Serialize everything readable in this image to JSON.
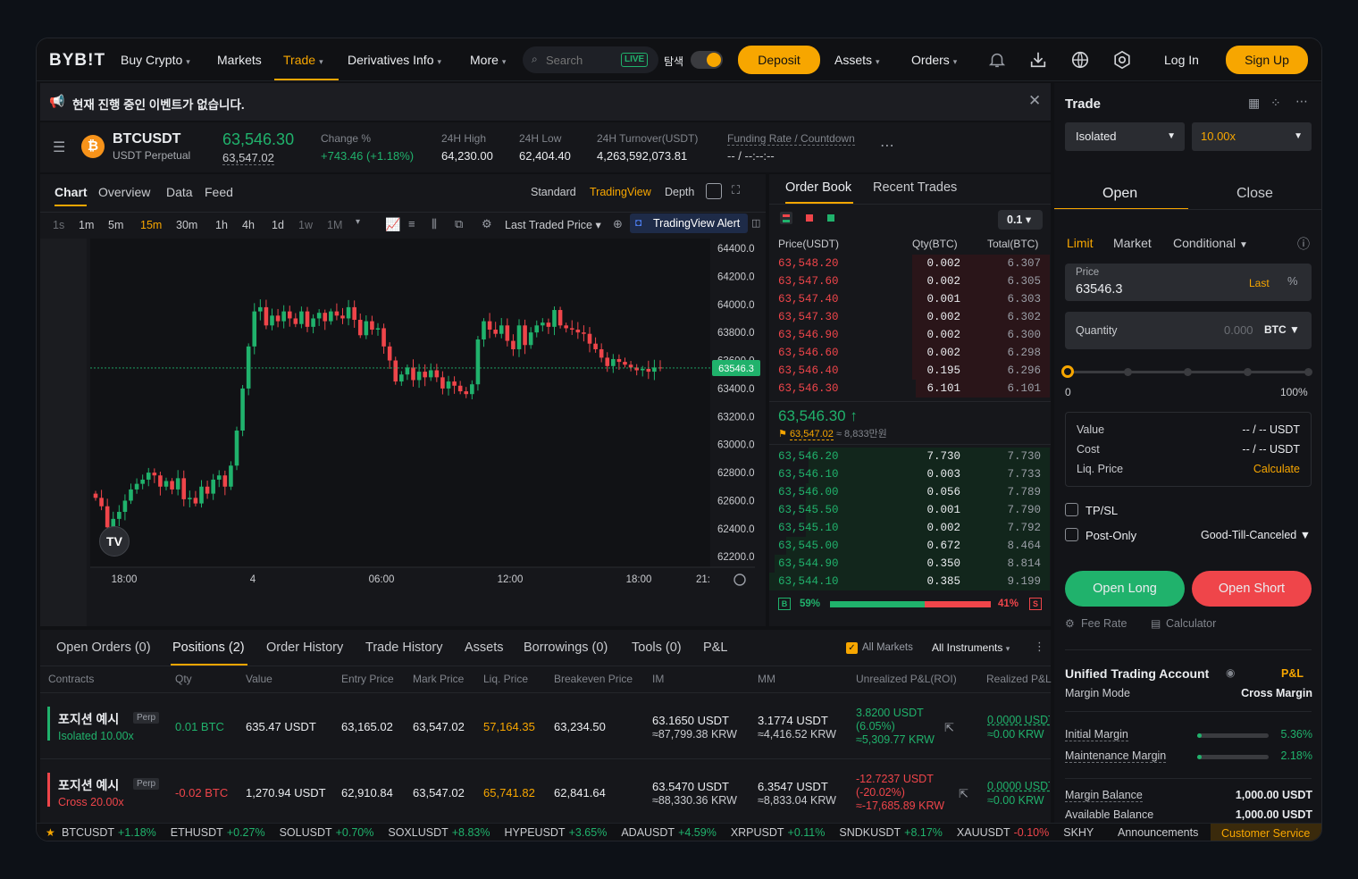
{
  "nav": {
    "logo": "BYB!T",
    "buy_crypto": "Buy Crypto",
    "markets": "Markets",
    "trade": "Trade",
    "derivatives": "Derivatives Info",
    "more": "More",
    "search_placeholder": "Search",
    "live": "LIVE",
    "explore": "탐색",
    "deposit": "Deposit",
    "assets": "Assets",
    "orders": "Orders",
    "login": "Log In",
    "signup": "Sign Up"
  },
  "notice": {
    "text": "현재 진행 중인 이벤트가 없습니다."
  },
  "ticker": {
    "symbol": "BTCUSDT",
    "type": "USDT Perpetual",
    "price": "63,546.30",
    "mark": "63,547.02",
    "change_label": "Change %",
    "change": "+743.46 (+1.18%)",
    "high_label": "24H High",
    "high": "64,230.00",
    "low_label": "24H Low",
    "low": "62,404.40",
    "turnover_label": "24H Turnover(USDT)",
    "turnover": "4,263,592,073.81",
    "funding_label": "Funding Rate / Countdown",
    "funding": "-- / --:--:--"
  },
  "chart_tabs": {
    "chart": "Chart",
    "overview": "Overview",
    "data": "Data",
    "feed": "Feed",
    "standard": "Standard",
    "tradingview": "TradingView",
    "depth": "Depth"
  },
  "intervals": [
    "1s",
    "1m",
    "5m",
    "15m",
    "30m",
    "1h",
    "4h",
    "1d",
    "1w",
    "1M"
  ],
  "chart_toolbar": {
    "last_traded": "Last Traded Price",
    "alert": "TradingView Alert"
  },
  "chart_data": {
    "type": "candlestick",
    "symbol": "BTCUSDT",
    "interval": "15m",
    "y_ticks": [
      "64400.0",
      "64200.0",
      "64000.0",
      "63800.0",
      "63600.0",
      "63400.0",
      "63200.0",
      "63000.0",
      "62800.0",
      "62600.0",
      "62400.0",
      "62200.0"
    ],
    "x_ticks": [
      "18:00",
      "4",
      "06:00",
      "12:00",
      "18:00",
      "21:"
    ],
    "ylim": [
      62125,
      64470
    ],
    "last_price": "63546.3",
    "closes": [
      62620,
      62560,
      62410,
      62470,
      62520,
      62600,
      62680,
      62720,
      62750,
      62800,
      62780,
      62700,
      62740,
      62680,
      62760,
      62610,
      62620,
      62580,
      62700,
      62650,
      62750,
      62780,
      62700,
      62850,
      63100,
      63400,
      63700,
      63950,
      63980,
      63850,
      63920,
      63880,
      63950,
      63900,
      63860,
      63950,
      63840,
      63900,
      63940,
      63880,
      63950,
      63920,
      63900,
      63980,
      63890,
      63780,
      63880,
      63820,
      63830,
      63700,
      63600,
      63450,
      63500,
      63550,
      63460,
      63520,
      63480,
      63530,
      63480,
      63400,
      63450,
      63420,
      63380,
      63360,
      63430,
      63750,
      63880,
      63820,
      63790,
      63850,
      63740,
      63680,
      63850,
      63710,
      63800,
      63850,
      63870,
      63840,
      63960,
      63850,
      63830,
      63820,
      63800,
      63790,
      63720,
      63680,
      63620,
      63560,
      63610,
      63590,
      63570,
      63550,
      63530,
      63540,
      63520,
      63550,
      63546
    ]
  },
  "orderbook": {
    "tab_book": "Order Book",
    "tab_trades": "Recent Trades",
    "precision": "0.1",
    "h_price": "Price(USDT)",
    "h_qty": "Qty(BTC)",
    "h_total": "Total(BTC)",
    "asks": [
      [
        "63,548.20",
        "0.002",
        "6.307",
        0.72
      ],
      [
        "63,547.60",
        "0.002",
        "6.305",
        0.72
      ],
      [
        "63,547.40",
        "0.001",
        "6.303",
        0.72
      ],
      [
        "63,547.30",
        "0.002",
        "6.302",
        0.72
      ],
      [
        "63,546.90",
        "0.002",
        "6.300",
        0.72
      ],
      [
        "63,546.60",
        "0.002",
        "6.298",
        0.72
      ],
      [
        "63,546.40",
        "0.195",
        "6.296",
        0.72
      ],
      [
        "63,546.30",
        "6.101",
        "6.101",
        0.7
      ]
    ],
    "last_price": "63,546.30",
    "mark_price": "63,547.02",
    "krw": "≈ 8,833만원",
    "bids": [
      [
        "63,546.20",
        "7.730",
        "7.730",
        0.86
      ],
      [
        "63,546.10",
        "0.003",
        "7.733",
        0.86
      ],
      [
        "63,546.00",
        "0.056",
        "7.789",
        0.87
      ],
      [
        "63,545.50",
        "0.001",
        "7.790",
        0.87
      ],
      [
        "63,545.10",
        "0.002",
        "7.792",
        0.87
      ],
      [
        "63,545.00",
        "0.672",
        "8.464",
        0.94
      ],
      [
        "63,544.90",
        "0.350",
        "8.814",
        0.98
      ],
      [
        "63,544.10",
        "0.385",
        "9.199",
        1.0
      ]
    ],
    "buy_pct": "59%",
    "sell_pct": "41%",
    "buy_ratio": 0.59,
    "b": "B",
    "s": "S"
  },
  "trade": {
    "title": "Trade",
    "margin": "Isolated",
    "leverage": "10.00x",
    "open": "Open",
    "close": "Close",
    "limit": "Limit",
    "market": "Market",
    "conditional": "Conditional",
    "price_label": "Price",
    "price_value": "63546.3",
    "last": "Last",
    "qty_label": "Quantity",
    "qty_value": "0.000",
    "qty_unit": "BTC",
    "slider_min": "0",
    "slider_max": "100%",
    "value_label": "Value",
    "value": "-- / -- USDT",
    "cost_label": "Cost",
    "cost": "-- / -- USDT",
    "liq_label": "Liq. Price",
    "calculate": "Calculate",
    "tpsl": "TP/SL",
    "postonly": "Post-Only",
    "gtc": "Good-Till-Canceled",
    "long": "Open Long",
    "short": "Open Short",
    "fee_rate": "Fee Rate",
    "calculator": "Calculator"
  },
  "account": {
    "title": "Unified Trading Account",
    "pnl": "P&L",
    "margin_mode_label": "Margin Mode",
    "margin_mode": "Cross Margin",
    "im_label": "Initial Margin",
    "im": "5.36%",
    "im_ratio": 0.0536,
    "mm_label": "Maintenance Margin",
    "mm": "2.18%",
    "mm_ratio": 0.0218,
    "balance_label": "Margin Balance",
    "balance": "1,000.00 USDT",
    "available_label": "Available Balance",
    "available": "1,000.00 USDT"
  },
  "bottom_tabs": [
    "Open Orders (0)",
    "Positions (2)",
    "Order History",
    "Trade History",
    "Assets",
    "Borrowings (0)",
    "Tools (0)",
    "P&L"
  ],
  "filters": {
    "all_markets": "All Markets",
    "all_instruments": "All Instruments"
  },
  "columns": [
    "Contracts",
    "Qty",
    "Value",
    "Entry Price",
    "Mark Price",
    "Liq. Price",
    "Breakeven Price",
    "IM",
    "MM",
    "Unrealized P&L(ROI)",
    "Realized P&L"
  ],
  "positions": [
    {
      "name": "포지션 예시",
      "tag": "Perp",
      "mode": "Isolated 10.00x",
      "qty": "0.01 BTC",
      "value": "635.47 USDT",
      "entry": "63,165.02",
      "mark": "63,547.02",
      "liq": "57,164.35",
      "breakeven": "63,234.50",
      "im": "63.1650 USDT",
      "im_krw": "≈87,799.38 KRW",
      "mm": "3.1774 USDT",
      "mm_krw": "≈4,416.52 KRW",
      "upnl": "3.8200 USDT",
      "roi": "(6.05%)",
      "upnl_krw": "≈5,309.77 KRW",
      "rpnl": "0.0000 USDT",
      "rpnl_krw": "≈0.00 KRW"
    },
    {
      "name": "포지션 예시",
      "tag": "Perp",
      "mode": "Cross 20.00x",
      "qty": "-0.02 BTC",
      "value": "1,270.94 USDT",
      "entry": "62,910.84",
      "mark": "63,547.02",
      "liq": "65,741.82",
      "breakeven": "62,841.64",
      "im": "63.5470 USDT",
      "im_krw": "≈88,330.36 KRW",
      "mm": "6.3547 USDT",
      "mm_krw": "≈8,833.04 KRW",
      "upnl": "-12.7237 USDT",
      "roi": "(-20.02%)",
      "upnl_krw": "≈-17,685.89 KRW",
      "rpnl": "0.0000 USDT",
      "rpnl_krw": "≈0.00 KRW"
    }
  ],
  "tape": [
    [
      "BTCUSDT",
      "+1.18%"
    ],
    [
      "ETHUSDT",
      "+0.27%"
    ],
    [
      "SOLUSDT",
      "+0.70%"
    ],
    [
      "SOXLUSDT",
      "+8.83%"
    ],
    [
      "HYPEUSDT",
      "+3.65%"
    ],
    [
      "ADAUSDT",
      "+4.59%"
    ],
    [
      "XRPUSDT",
      "+0.11%"
    ],
    [
      "SNDKUSDT",
      "+8.17%"
    ],
    [
      "XAUUSDT",
      "-0.10%"
    ],
    [
      "SKHY",
      ""
    ]
  ],
  "footer": {
    "announcements": "Announcements",
    "support": "Customer Service"
  },
  "colors": {
    "accent": "#f7a600",
    "up": "#20b26c",
    "down": "#ef454a"
  }
}
